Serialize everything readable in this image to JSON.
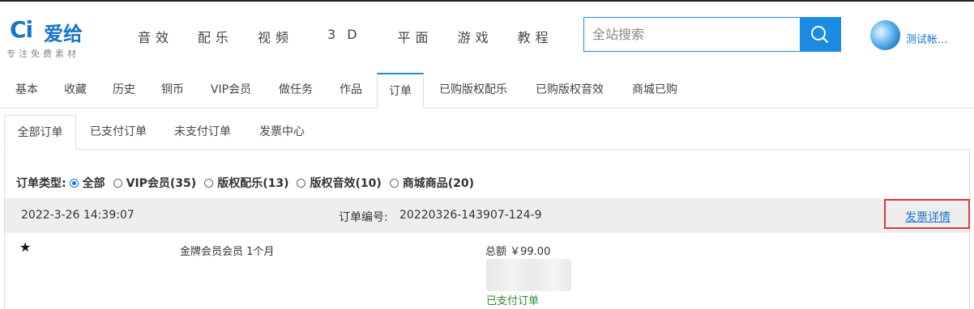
{
  "header": {
    "logo_mark": "Ci",
    "logo_text": "爱给",
    "logo_sub": "专注免费素材",
    "nav": [
      "音效",
      "配乐",
      "视频",
      "3D",
      "平面",
      "游戏",
      "教程"
    ],
    "search_placeholder": "全站搜索",
    "username": "测试帐..."
  },
  "main_tabs": [
    "基本",
    "收藏",
    "历史",
    "铜币",
    "VIP会员",
    "做任务",
    "作品",
    "订单",
    "已购版权配乐",
    "已购版权音效",
    "商城已购"
  ],
  "main_tab_active": "订单",
  "sub_tabs": [
    "全部订单",
    "已支付订单",
    "未支付订单",
    "发票中心"
  ],
  "sub_tab_active": "全部订单",
  "filter": {
    "label": "订单类型:",
    "options": [
      "全部",
      "VIP会员(35)",
      "版权配乐(13)",
      "版权音效(10)",
      "商城商品(20)"
    ],
    "selected": "全部"
  },
  "order": {
    "date": "2022-3-26 14:39:07",
    "number_label": "订单编号:",
    "number": "20220326-143907-124-9",
    "invoice_link": "发票详情",
    "star": "★",
    "product": "金牌会员会员 1个月",
    "total": "总额 ￥99.00",
    "status": "已支付订单"
  },
  "colors": {
    "accent": "#1a8be0",
    "highlight_box": "#e03a3a",
    "paid_status": "#2e8b2e"
  },
  "icons": [
    "search-icon",
    "avatar"
  ]
}
